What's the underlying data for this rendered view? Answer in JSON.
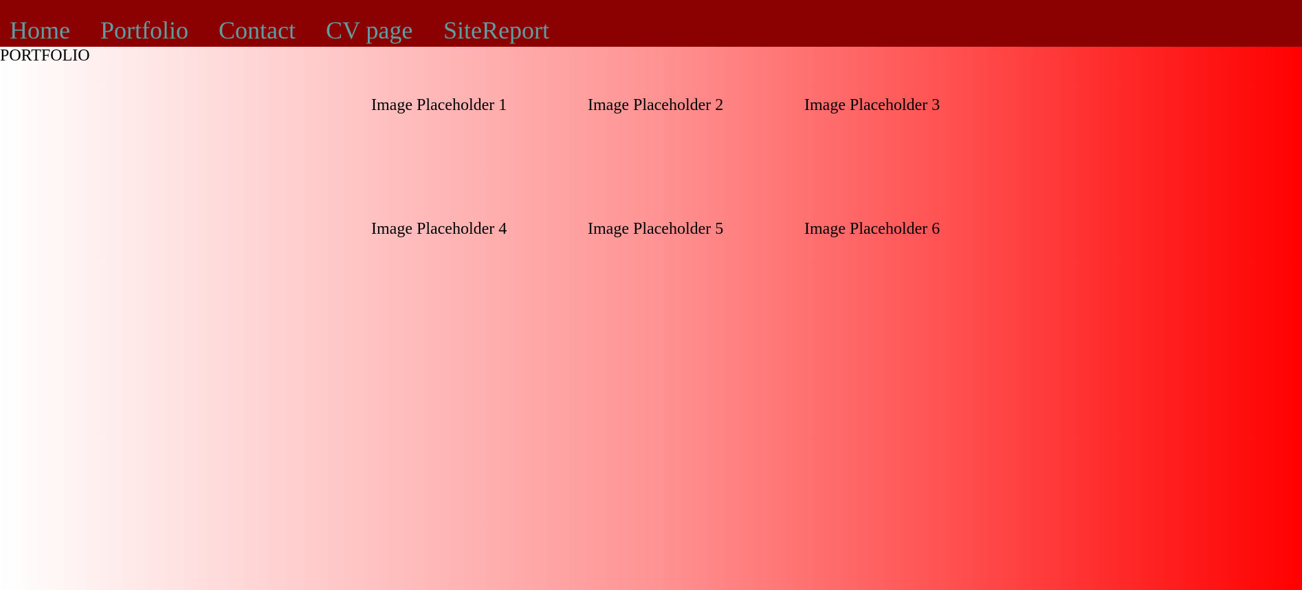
{
  "nav": {
    "items": [
      {
        "label": "Home"
      },
      {
        "label": "Portfolio"
      },
      {
        "label": "Contact"
      },
      {
        "label": "CV page"
      },
      {
        "label": "SiteReport"
      }
    ]
  },
  "page": {
    "title": "PORTFOLIO"
  },
  "gallery": {
    "placeholders": [
      {
        "label": "Image Placeholder 1"
      },
      {
        "label": "Image Placeholder 2"
      },
      {
        "label": "Image Placeholder 3"
      },
      {
        "label": "Image Placeholder 4"
      },
      {
        "label": "Image Placeholder 5"
      },
      {
        "label": "Image Placeholder 6"
      }
    ]
  },
  "colors": {
    "navbar_background": "#8b0000",
    "nav_link": "#5f9ea0",
    "gradient_start": "#ffffff",
    "gradient_end": "#ff0000",
    "text": "#000000"
  }
}
